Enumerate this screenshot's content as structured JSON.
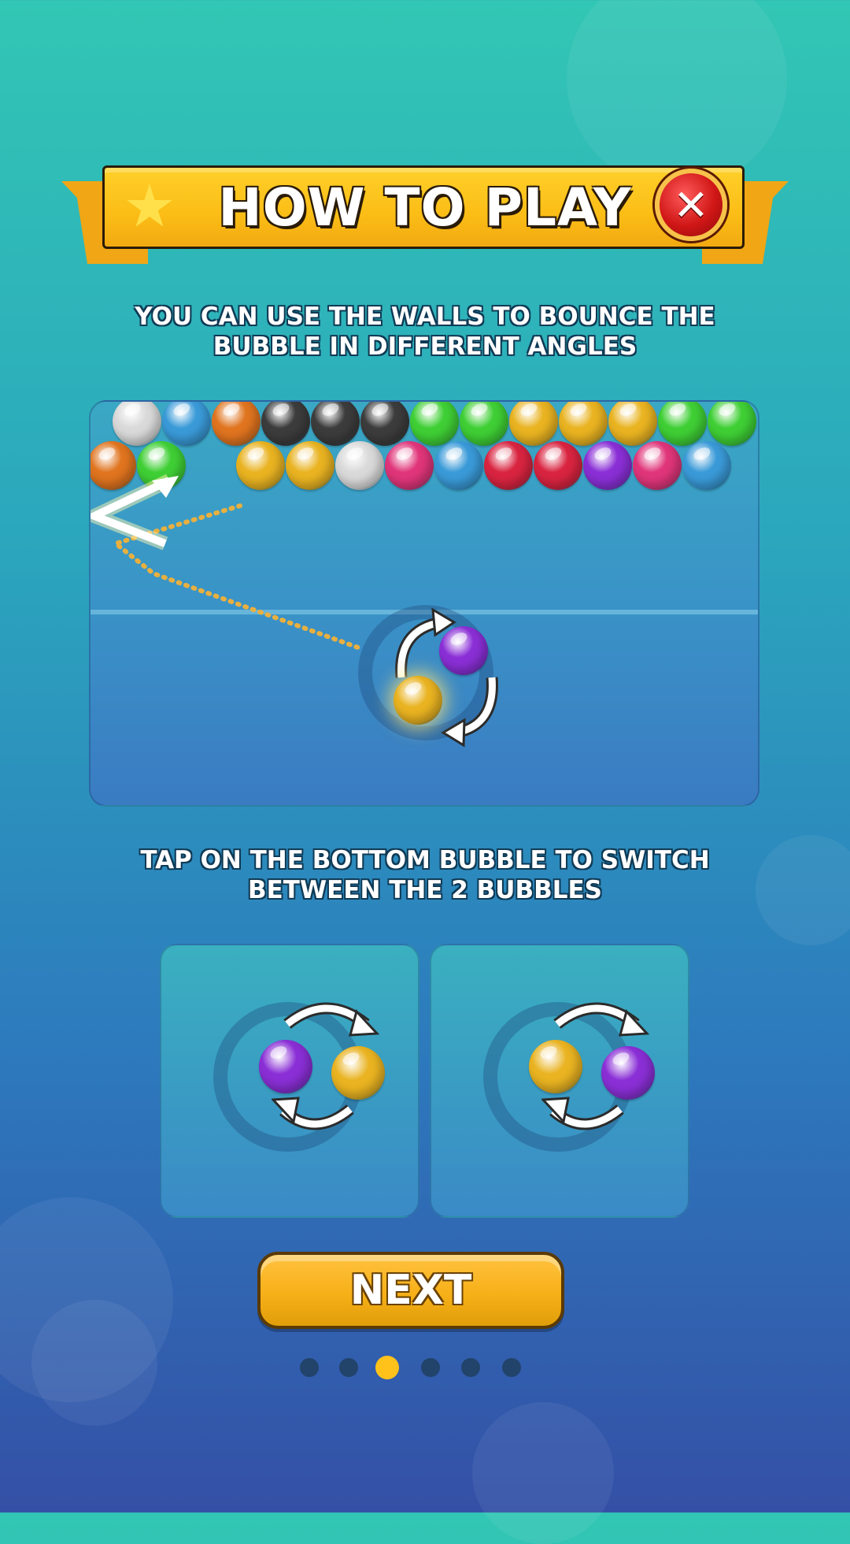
{
  "header": {
    "title": "HOW TO PLAY",
    "close_glyph": "✕",
    "star_icon": "star-icon"
  },
  "tip_1": {
    "line1": "YOU CAN USE THE WALLS TO BOUNCE THE",
    "line2": "BUBBLE IN DIFFERENT ANGLES"
  },
  "tip_2": {
    "line1": "TAP ON THE BOTTOM BUBBLE TO SWITCH",
    "line2": "BETWEEN THE 2 BUBBLES"
  },
  "bubble_colors": {
    "white": "#d9d9d9",
    "blue": "#3a9ad8",
    "orange": "#e0741f",
    "black": "#3c3c3c",
    "green": "#3fcf35",
    "yellow": "#e9b321",
    "pink": "#e0357a",
    "red": "#d92440",
    "purple": "#8a2fd6"
  },
  "field": {
    "row1": [
      "white",
      "blue",
      "orange",
      "black",
      "black",
      "black",
      "green",
      "green",
      "yellow",
      "yellow",
      "yellow",
      "green",
      "green"
    ],
    "row2": [
      "orange",
      "green",
      "",
      "yellow",
      "yellow",
      "white",
      "pink",
      "blue",
      "red",
      "red",
      "purple",
      "pink",
      "blue"
    ],
    "shooter_current": "yellow",
    "shooter_next": "purple"
  },
  "swap_examples": [
    {
      "left": "purple",
      "right": "yellow"
    },
    {
      "left": "yellow",
      "right": "purple"
    }
  ],
  "next_button": {
    "label": "NEXT"
  },
  "pagination": {
    "total": 6,
    "active_index": 2
  }
}
